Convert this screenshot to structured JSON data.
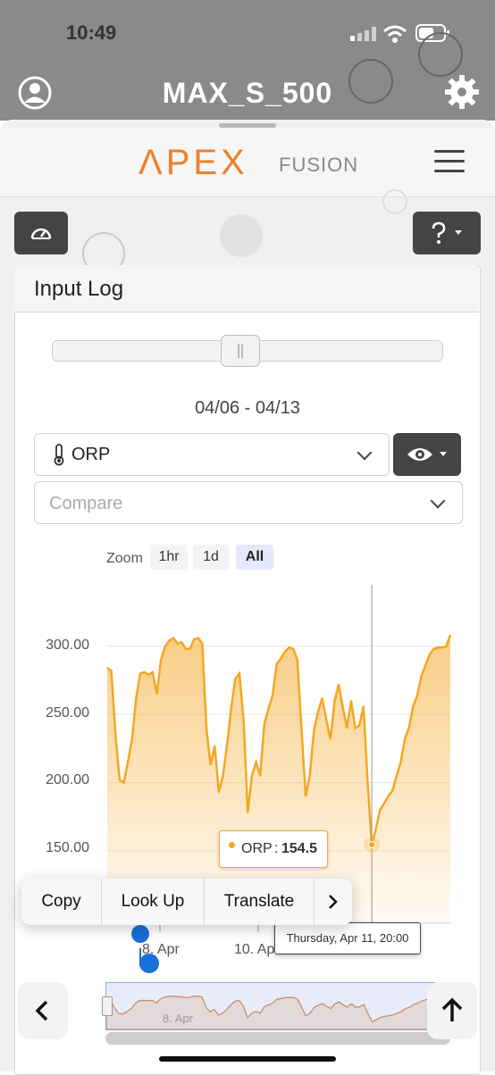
{
  "status_bar": {
    "time": "10:49"
  },
  "header": {
    "title": "MAX_S_500"
  },
  "brand": {
    "apex": "ΛPEX",
    "fusion": "FUSION",
    "accent": "#f07f2a"
  },
  "toolbar": {
    "dashboard_icon": "gauge-icon",
    "help_icon": "question-icon"
  },
  "panel": {
    "title": "Input Log",
    "date_range": "04/06 - 04/13",
    "input_select": "ORP",
    "compare_placeholder": "Compare"
  },
  "zoom": {
    "label": "Zoom",
    "options": [
      "1hr",
      "1d",
      "All"
    ],
    "selected": "All"
  },
  "chart_data": {
    "type": "area",
    "series": [
      {
        "name": "ORP",
        "color": "#f5a623",
        "points": [
          [
            "04/06 12:00",
            284
          ],
          [
            "04/06 14:00",
            282
          ],
          [
            "04/06 16:00",
            235
          ],
          [
            "04/06 18:00",
            202
          ],
          [
            "04/06 20:00",
            200
          ],
          [
            "04/06 22:00",
            215
          ],
          [
            "04/07 00:00",
            232
          ],
          [
            "04/07 02:00",
            262
          ],
          [
            "04/07 04:00",
            280
          ],
          [
            "04/07 06:00",
            281
          ],
          [
            "04/07 08:00",
            279
          ],
          [
            "04/07 10:00",
            281
          ],
          [
            "04/07 12:00",
            265
          ],
          [
            "04/07 14:00",
            290
          ],
          [
            "04/07 16:00",
            300
          ],
          [
            "04/07 18:00",
            304
          ],
          [
            "04/07 20:00",
            306
          ],
          [
            "04/07 22:00",
            302
          ],
          [
            "04/08 00:00",
            303
          ],
          [
            "04/08 02:00",
            298
          ],
          [
            "04/08 04:00",
            298
          ],
          [
            "04/08 06:00",
            305
          ],
          [
            "04/08 08:00",
            306
          ],
          [
            "04/08 10:00",
            302
          ],
          [
            "04/08 12:00",
            240
          ],
          [
            "04/08 14:00",
            213
          ],
          [
            "04/08 16:00",
            227
          ],
          [
            "04/08 18:00",
            193
          ],
          [
            "04/08 20:00",
            205
          ],
          [
            "04/08 22:00",
            228
          ],
          [
            "04/09 00:00",
            255
          ],
          [
            "04/09 02:00",
            276
          ],
          [
            "04/09 04:00",
            280
          ],
          [
            "04/09 06:00",
            245
          ],
          [
            "04/09 08:00",
            178
          ],
          [
            "04/09 10:00",
            205
          ],
          [
            "04/09 12:00",
            215
          ],
          [
            "04/09 14:00",
            205
          ],
          [
            "04/09 16:00",
            243
          ],
          [
            "04/09 18:00",
            254
          ],
          [
            "04/09 20:00",
            264
          ],
          [
            "04/09 22:00",
            287
          ],
          [
            "04/10 00:00",
            291
          ],
          [
            "04/10 02:00",
            296
          ],
          [
            "04/10 04:00",
            299
          ],
          [
            "04/10 06:00",
            298
          ],
          [
            "04/10 08:00",
            290
          ],
          [
            "04/10 10:00",
            240
          ],
          [
            "04/10 12:00",
            190
          ],
          [
            "04/10 14:00",
            205
          ],
          [
            "04/10 16:00",
            238
          ],
          [
            "04/10 18:00",
            252
          ],
          [
            "04/10 20:00",
            262
          ],
          [
            "04/10 22:00",
            246
          ],
          [
            "04/11 00:00",
            232
          ],
          [
            "04/11 02:00",
            260
          ],
          [
            "04/11 04:00",
            272
          ],
          [
            "04/11 06:00",
            255
          ],
          [
            "04/11 08:00",
            240
          ],
          [
            "04/11 10:00",
            260
          ],
          [
            "04/11 12:00",
            240
          ],
          [
            "04/11 14:00",
            242
          ],
          [
            "04/11 16:00",
            256
          ],
          [
            "04/11 18:00",
            200
          ],
          [
            "04/11 20:00",
            154.5
          ],
          [
            "04/11 22:00",
            166
          ],
          [
            "04/12 00:00",
            180
          ],
          [
            "04/12 02:00",
            185
          ],
          [
            "04/12 04:00",
            190
          ],
          [
            "04/12 06:00",
            194
          ],
          [
            "04/12 08:00",
            205
          ],
          [
            "04/12 10:00",
            215
          ],
          [
            "04/12 12:00",
            232
          ],
          [
            "04/12 14:00",
            240
          ],
          [
            "04/12 16:00",
            256
          ],
          [
            "04/12 18:00",
            264
          ],
          [
            "04/12 20:00",
            278
          ],
          [
            "04/12 22:00",
            286
          ],
          [
            "04/13 00:00",
            294
          ],
          [
            "04/13 02:00",
            298
          ],
          [
            "04/13 04:00",
            299
          ],
          [
            "04/13 06:00",
            299
          ],
          [
            "04/13 08:00",
            300
          ],
          [
            "04/13 10:00",
            308
          ]
        ]
      }
    ],
    "y_ticks": [
      "300.00",
      "250.00",
      "200.00",
      "150.00"
    ],
    "ylim": [
      97,
      345
    ],
    "x_ticks": [
      "8. Apr",
      "10. Ap"
    ],
    "xlim": [
      "04/06 12:00",
      "04/13 10:00"
    ],
    "tooltip": {
      "series": "ORP",
      "value": "154.5",
      "x_label": "Thursday, Apr 11, 20:00",
      "x": "04/11 20:00"
    },
    "navigator_label": "8. Apr",
    "grid": true,
    "legend": "none"
  },
  "context_menu": {
    "items": [
      "Copy",
      "Look Up",
      "Translate"
    ]
  },
  "bottom": {
    "back_icon": "chevron-left-icon",
    "up_icon": "arrow-up-icon"
  }
}
